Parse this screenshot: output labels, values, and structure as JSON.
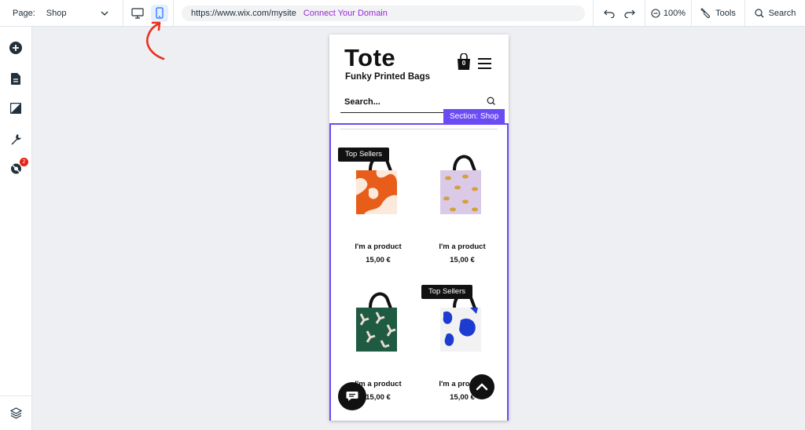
{
  "topbar": {
    "page_label": "Page:",
    "page_value": "Shop",
    "url": "https://www.wix.com/mysite",
    "connect_domain": "Connect Your Domain",
    "zoom": "100%",
    "tools": "Tools",
    "search": "Search"
  },
  "leftbar": {
    "hidden_badge": "2"
  },
  "site": {
    "title": "Tote",
    "subtitle": "Funky Printed Bags",
    "cart_count": "0",
    "search_placeholder": "Search...",
    "section_tag": "Section: Shop"
  },
  "products": [
    {
      "ribbon": "Top Sellers",
      "name": "I'm a product",
      "price": "15,00 €"
    },
    {
      "ribbon": "",
      "name": "I'm a product",
      "price": "15,00 €"
    },
    {
      "ribbon": "",
      "name": "I'm a product",
      "price": "15,00 €"
    },
    {
      "ribbon": "Top Sellers",
      "name": "I'm a product",
      "price": "15,00 €"
    }
  ],
  "colors": {
    "accent": "#6b4bf4",
    "connect": "#9a27d5",
    "annotation": "#e8321e",
    "badge": "#e62214"
  },
  "icons": [
    "chevron-down-icon",
    "desktop-icon",
    "mobile-icon",
    "undo-icon",
    "redo-icon",
    "zoom-out-icon",
    "tools-icon",
    "search-icon",
    "add-icon",
    "pages-icon",
    "design-icon",
    "settings-icon",
    "hidden-elements-icon",
    "layers-icon",
    "cart-icon",
    "menu-icon",
    "chat-icon",
    "back-to-top-icon"
  ]
}
